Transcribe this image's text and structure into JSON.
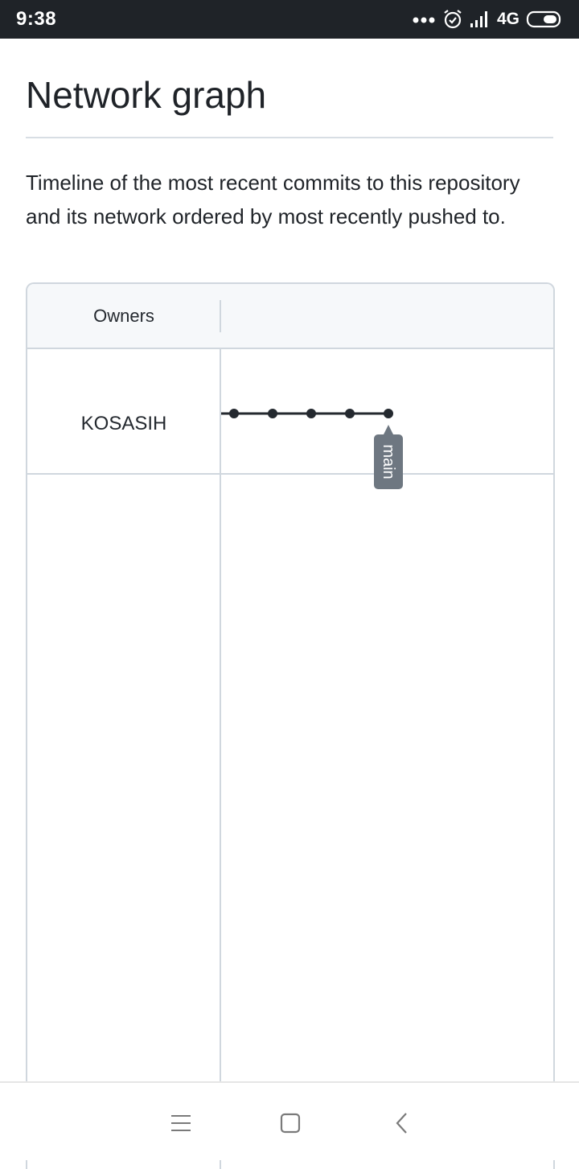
{
  "status_bar": {
    "time": "9:38",
    "network": "4G",
    "icons": [
      "more-dots-icon",
      "alarm-icon",
      "signal-icon",
      "battery-icon"
    ]
  },
  "page": {
    "title": "Network graph",
    "description": "Timeline of the most recent commits to this repository and its network ordered by most recently pushed to."
  },
  "graph": {
    "owners_header": "Owners",
    "owners": [
      {
        "name": "KOSASIH",
        "commit_count": 5,
        "branch_label": "main"
      }
    ]
  },
  "nav_bar": {
    "icons": [
      "menu-icon",
      "home-icon",
      "back-icon"
    ]
  },
  "colors": {
    "status_bar_bg": "#1f2328",
    "graph_line": "#24292f",
    "branch_tag_bg": "#6e7781",
    "border": "#d0d7de",
    "header_bg": "#f6f8fa"
  }
}
